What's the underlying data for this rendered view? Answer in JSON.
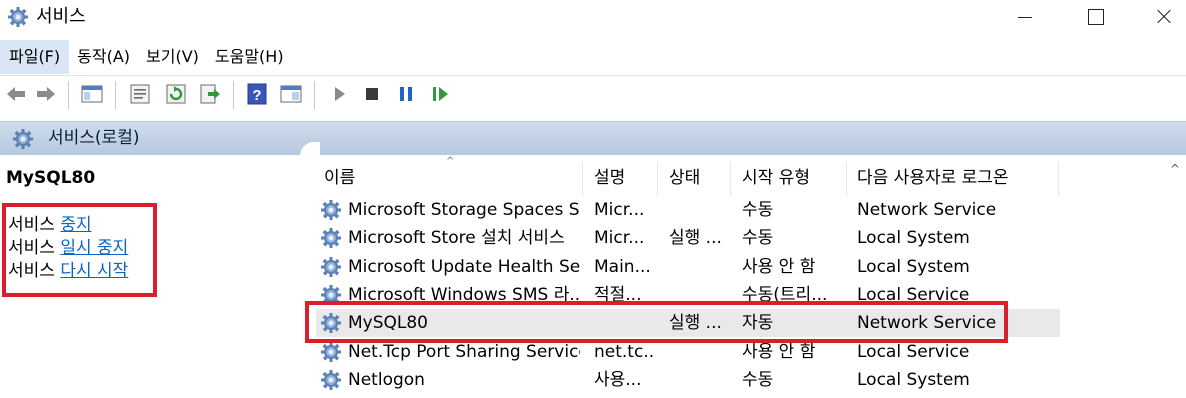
{
  "window": {
    "title": "서비스"
  },
  "menu": [
    "파일(F)",
    "동작(A)",
    "보기(V)",
    "도움말(H)"
  ],
  "header": {
    "title": "서비스(로컬)"
  },
  "left": {
    "service_name": "MySQL80",
    "actions": [
      {
        "prefix": "서비스 ",
        "link": "중지"
      },
      {
        "prefix": "서비스 ",
        "link": "일시 중지"
      },
      {
        "prefix": "서비스 ",
        "link": "다시 시작"
      }
    ]
  },
  "columns": [
    "이름",
    "설명",
    "상태",
    "시작 유형",
    "다음 사용자로 로그온"
  ],
  "rows": [
    {
      "name": "Microsoft Storage Spaces S...",
      "desc": "Micr...",
      "status": "",
      "startup": "수동",
      "logon": "Network Service"
    },
    {
      "name": "Microsoft Store 설치 서비스",
      "desc": "Micr...",
      "status": "실행 ...",
      "startup": "수동",
      "logon": "Local System"
    },
    {
      "name": "Microsoft Update Health Se...",
      "desc": "Main...",
      "status": "",
      "startup": "사용 안 함",
      "logon": "Local System"
    },
    {
      "name": "Microsoft Windows SMS 라...",
      "desc": "적절...",
      "status": "",
      "startup": "수동(트리...",
      "logon": "Local Service"
    },
    {
      "name": "MySQL80",
      "desc": "",
      "status": "실행 ...",
      "startup": "자동",
      "logon": "Network Service"
    },
    {
      "name": "Net.Tcp Port Sharing Service",
      "desc": "net.tc...",
      "status": "",
      "startup": "사용 안 함",
      "logon": "Local Service"
    },
    {
      "name": "Netlogon",
      "desc": "사용...",
      "status": "",
      "startup": "수동",
      "logon": "Local System"
    }
  ],
  "colors": {
    "highlight_border": "#d9202a",
    "link": "#0b65c8",
    "header_strip": "#c3d4e9",
    "selected_row": "#e9e9e9"
  },
  "icons": [
    "gear-icon",
    "back-icon",
    "forward-icon",
    "console-tree-icon",
    "properties-icon",
    "refresh-icon",
    "export-icon",
    "help-icon",
    "view-icon",
    "play-icon",
    "stop-icon",
    "pause-icon",
    "resume-icon"
  ]
}
